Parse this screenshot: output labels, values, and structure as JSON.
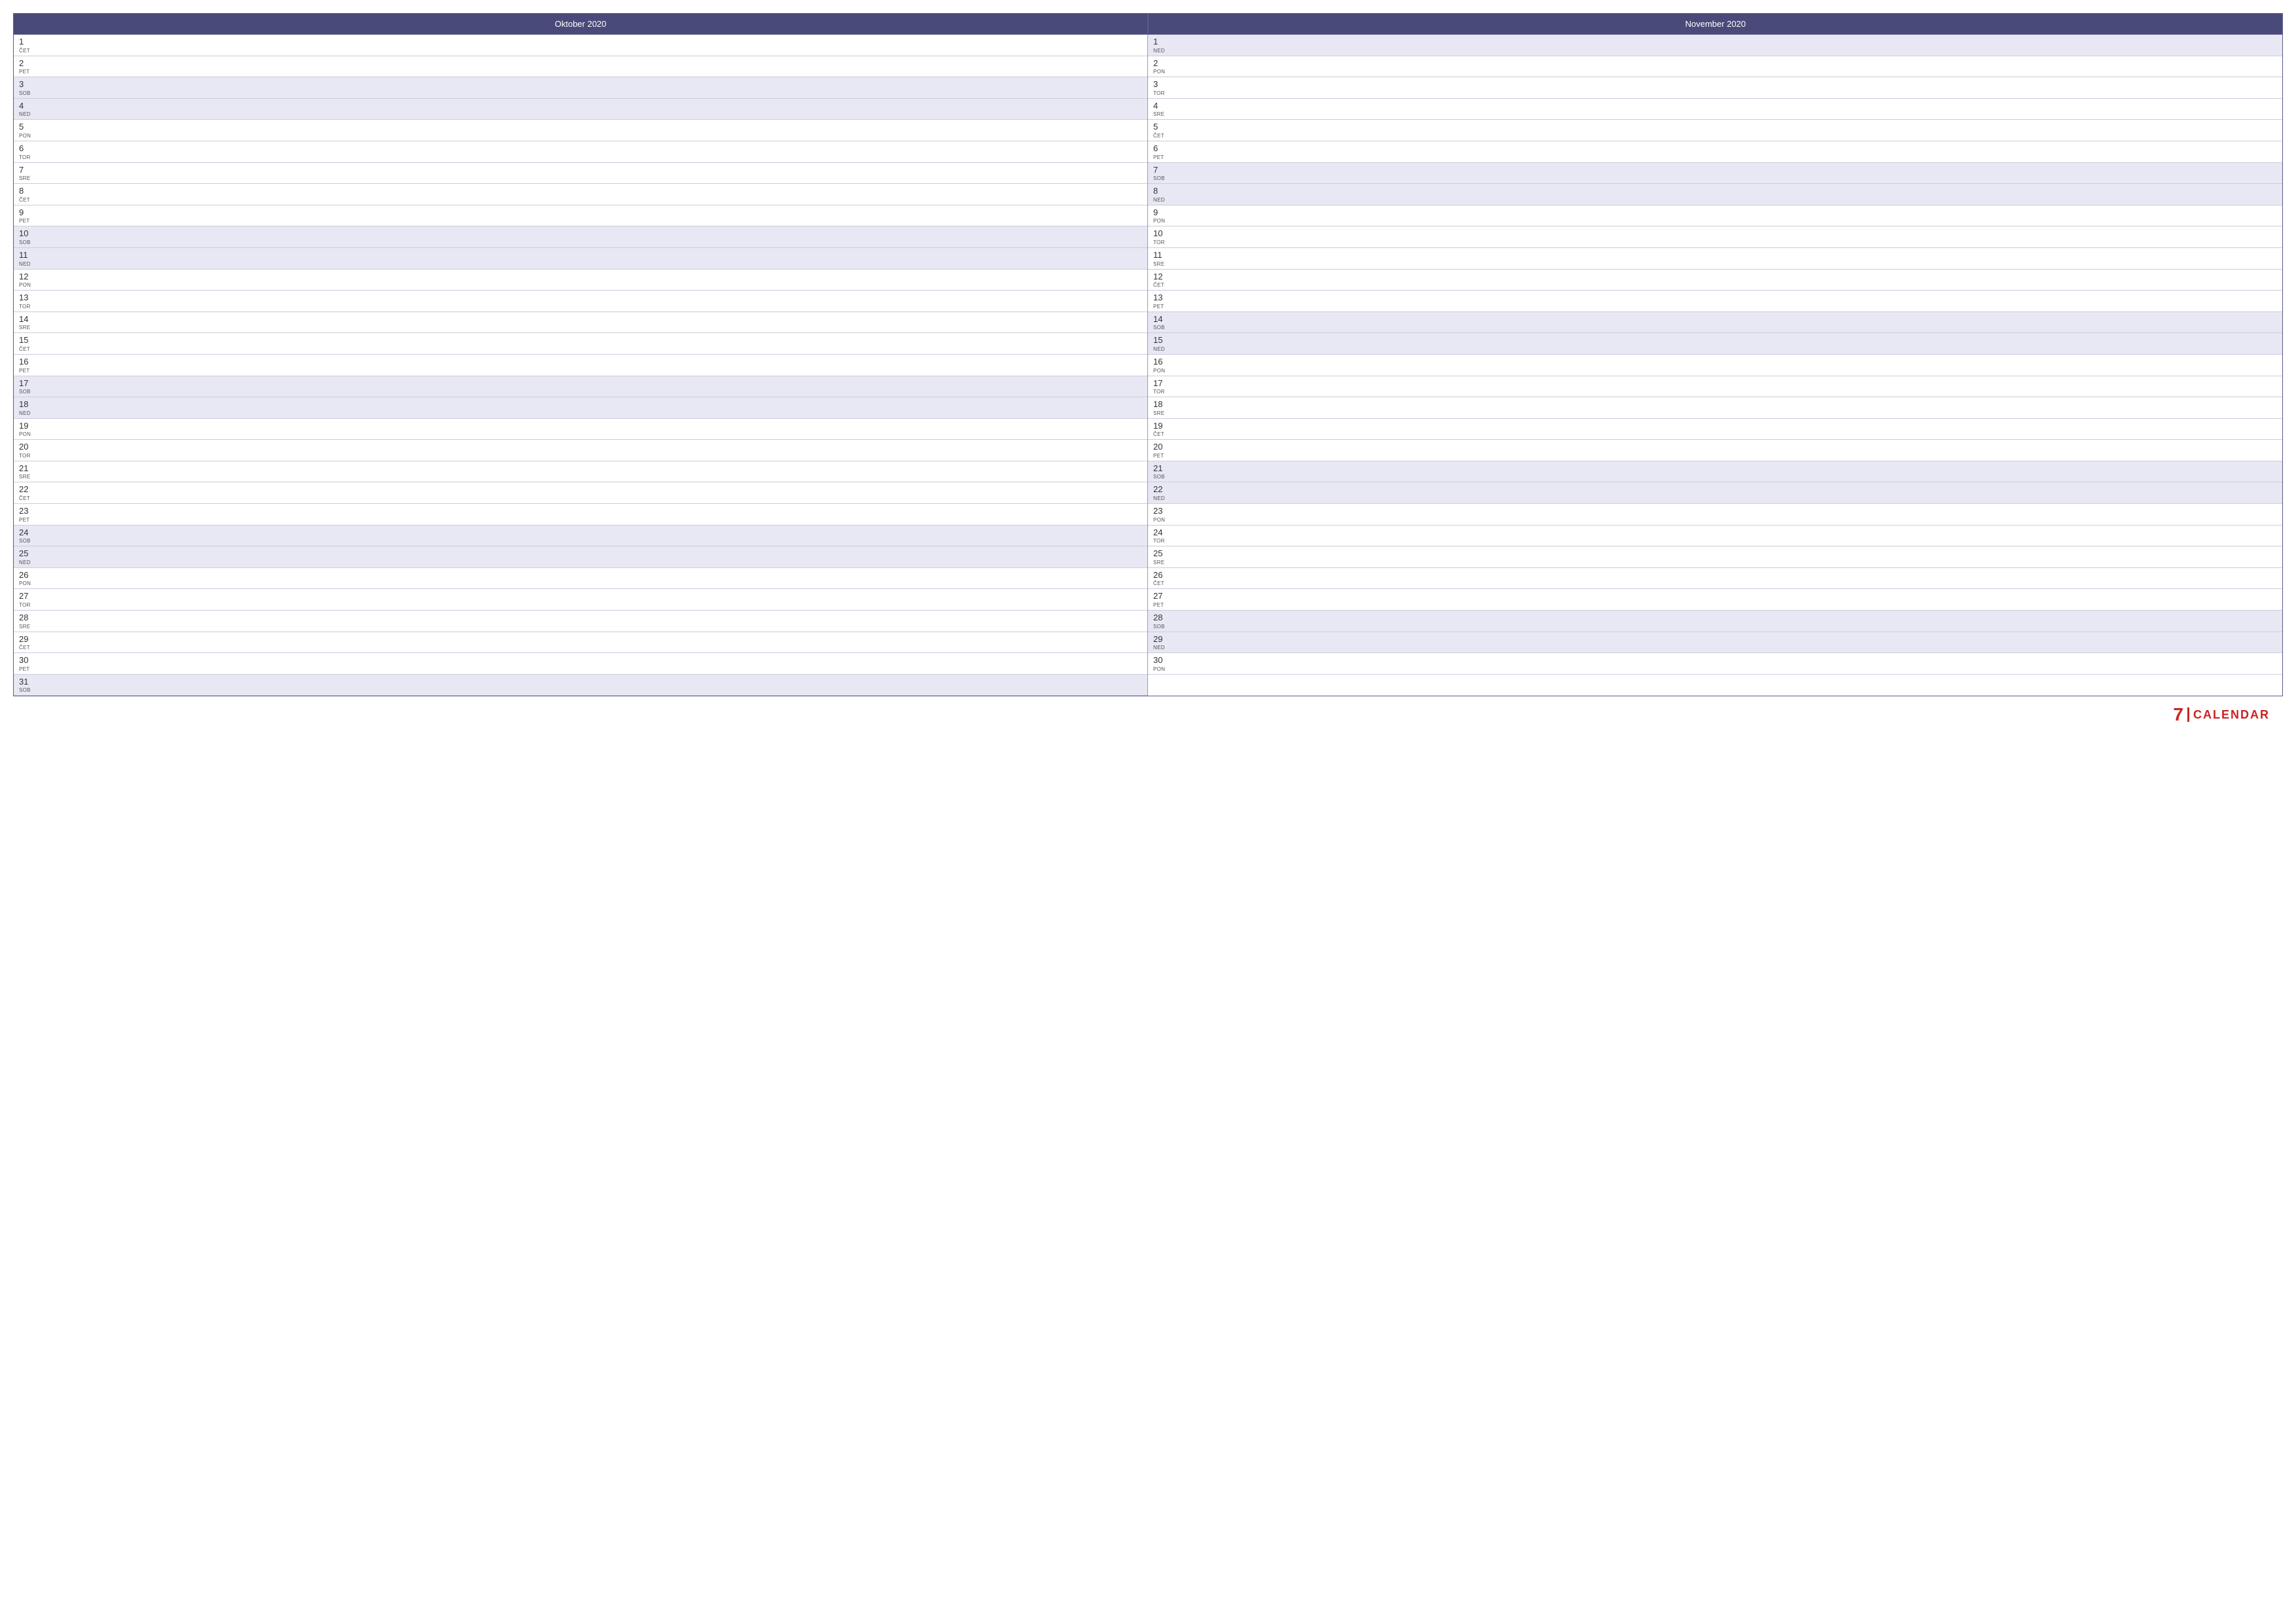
{
  "months": [
    {
      "name": "Oktober 2020",
      "days": [
        {
          "num": 1,
          "day": "ČET",
          "weekend": false
        },
        {
          "num": 2,
          "day": "PET",
          "weekend": false
        },
        {
          "num": 3,
          "day": "SOB",
          "weekend": true
        },
        {
          "num": 4,
          "day": "NED",
          "weekend": true
        },
        {
          "num": 5,
          "day": "PON",
          "weekend": false
        },
        {
          "num": 6,
          "day": "TOR",
          "weekend": false
        },
        {
          "num": 7,
          "day": "SRE",
          "weekend": false
        },
        {
          "num": 8,
          "day": "ČET",
          "weekend": false
        },
        {
          "num": 9,
          "day": "PET",
          "weekend": false
        },
        {
          "num": 10,
          "day": "SOB",
          "weekend": true
        },
        {
          "num": 11,
          "day": "NED",
          "weekend": true
        },
        {
          "num": 12,
          "day": "PON",
          "weekend": false
        },
        {
          "num": 13,
          "day": "TOR",
          "weekend": false
        },
        {
          "num": 14,
          "day": "SRE",
          "weekend": false
        },
        {
          "num": 15,
          "day": "ČET",
          "weekend": false
        },
        {
          "num": 16,
          "day": "PET",
          "weekend": false
        },
        {
          "num": 17,
          "day": "SOB",
          "weekend": true
        },
        {
          "num": 18,
          "day": "NED",
          "weekend": true
        },
        {
          "num": 19,
          "day": "PON",
          "weekend": false
        },
        {
          "num": 20,
          "day": "TOR",
          "weekend": false
        },
        {
          "num": 21,
          "day": "SRE",
          "weekend": false
        },
        {
          "num": 22,
          "day": "ČET",
          "weekend": false
        },
        {
          "num": 23,
          "day": "PET",
          "weekend": false
        },
        {
          "num": 24,
          "day": "SOB",
          "weekend": true
        },
        {
          "num": 25,
          "day": "NED",
          "weekend": true
        },
        {
          "num": 26,
          "day": "PON",
          "weekend": false
        },
        {
          "num": 27,
          "day": "TOR",
          "weekend": false
        },
        {
          "num": 28,
          "day": "SRE",
          "weekend": false
        },
        {
          "num": 29,
          "day": "ČET",
          "weekend": false
        },
        {
          "num": 30,
          "day": "PET",
          "weekend": false
        },
        {
          "num": 31,
          "day": "SOB",
          "weekend": true
        }
      ]
    },
    {
      "name": "November 2020",
      "days": [
        {
          "num": 1,
          "day": "NED",
          "weekend": true
        },
        {
          "num": 2,
          "day": "PON",
          "weekend": false
        },
        {
          "num": 3,
          "day": "TOR",
          "weekend": false
        },
        {
          "num": 4,
          "day": "SRE",
          "weekend": false
        },
        {
          "num": 5,
          "day": "ČET",
          "weekend": false
        },
        {
          "num": 6,
          "day": "PET",
          "weekend": false
        },
        {
          "num": 7,
          "day": "SOB",
          "weekend": true
        },
        {
          "num": 8,
          "day": "NED",
          "weekend": true
        },
        {
          "num": 9,
          "day": "PON",
          "weekend": false
        },
        {
          "num": 10,
          "day": "TOR",
          "weekend": false
        },
        {
          "num": 11,
          "day": "SRE",
          "weekend": false
        },
        {
          "num": 12,
          "day": "ČET",
          "weekend": false
        },
        {
          "num": 13,
          "day": "PET",
          "weekend": false
        },
        {
          "num": 14,
          "day": "SOB",
          "weekend": true
        },
        {
          "num": 15,
          "day": "NED",
          "weekend": true
        },
        {
          "num": 16,
          "day": "PON",
          "weekend": false
        },
        {
          "num": 17,
          "day": "TOR",
          "weekend": false
        },
        {
          "num": 18,
          "day": "SRE",
          "weekend": false
        },
        {
          "num": 19,
          "day": "ČET",
          "weekend": false
        },
        {
          "num": 20,
          "day": "PET",
          "weekend": false
        },
        {
          "num": 21,
          "day": "SOB",
          "weekend": true
        },
        {
          "num": 22,
          "day": "NED",
          "weekend": true
        },
        {
          "num": 23,
          "day": "PON",
          "weekend": false
        },
        {
          "num": 24,
          "day": "TOR",
          "weekend": false
        },
        {
          "num": 25,
          "day": "SRE",
          "weekend": false
        },
        {
          "num": 26,
          "day": "ČET",
          "weekend": false
        },
        {
          "num": 27,
          "day": "PET",
          "weekend": false
        },
        {
          "num": 28,
          "day": "SOB",
          "weekend": true
        },
        {
          "num": 29,
          "day": "NED",
          "weekend": true
        },
        {
          "num": 30,
          "day": "PON",
          "weekend": false
        }
      ]
    }
  ],
  "logo": {
    "number": "7",
    "text": "CALENDAR"
  }
}
